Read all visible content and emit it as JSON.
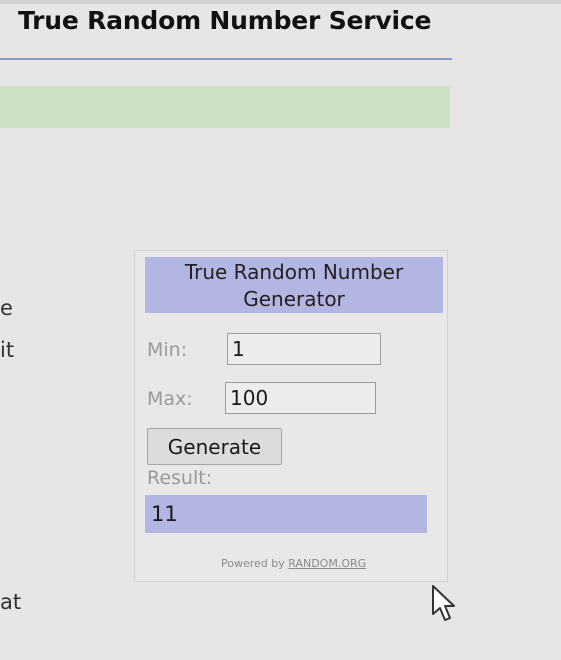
{
  "page": {
    "title": "True Random Number Service"
  },
  "fragments": {
    "left_1": "e",
    "left_2": "it",
    "left_3": "at"
  },
  "widget": {
    "header_line1": "True Random Number",
    "header_line2": "Generator",
    "min_label": "Min:",
    "min_value": "1",
    "max_label": "Max:",
    "max_value": "100",
    "generate_label": "Generate",
    "result_label": "Result:",
    "result_value": "11",
    "powered_prefix": "Powered by",
    "powered_link": "RANDOM.ORG"
  },
  "colors": {
    "header_bg": "#b3b5e2",
    "result_bg": "#b3b5e2",
    "green_bar": "#cbe0c4",
    "title_rule": "#8d95c9"
  },
  "icons": {
    "cursor": "mouse-pointer-icon"
  }
}
